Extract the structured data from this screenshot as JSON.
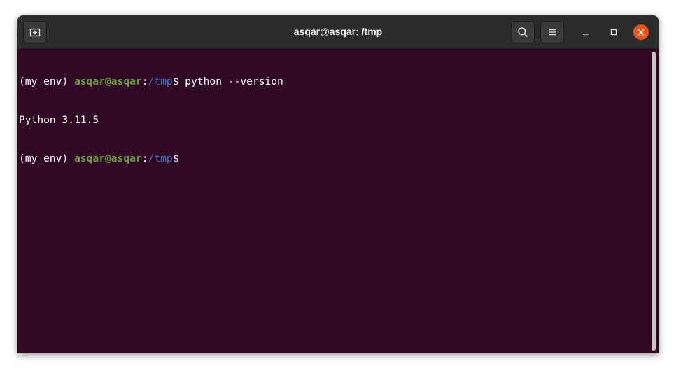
{
  "window": {
    "title": "asqar@asqar: /tmp"
  },
  "titlebar_buttons": {
    "new_tab_icon": "new-tab-icon",
    "search_icon": "search-icon",
    "menu_icon": "hamburger-menu-icon",
    "minimize_icon": "minimize-icon",
    "maximize_icon": "maximize-icon",
    "close_icon": "close-icon"
  },
  "terminal": {
    "lines": [
      {
        "env": "(my_env) ",
        "user": "asqar@asqar",
        "colon": ":",
        "path": "/tmp",
        "prompt": "$ ",
        "command": "python --version"
      },
      {
        "output": "Python 3.11.5"
      },
      {
        "env": "(my_env) ",
        "user": "asqar@asqar",
        "colon": ":",
        "path": "/tmp",
        "prompt": "$",
        "command": ""
      }
    ]
  },
  "colors": {
    "background": "#300a24",
    "titlebar": "#2c2c2c",
    "user": "#6ca33c",
    "path": "#3d74c4",
    "text": "#ffffff",
    "close_button": "#e95420"
  }
}
